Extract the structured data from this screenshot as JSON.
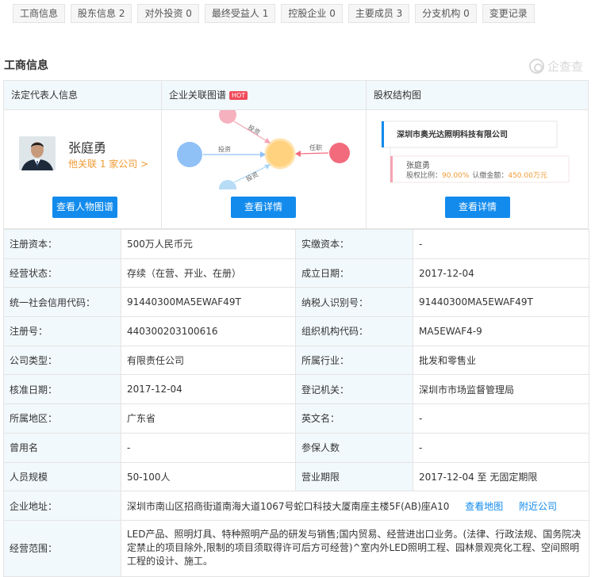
{
  "tabs": [
    "工商信息",
    "股东信息 2",
    "对外投资 0",
    "最终受益人 1",
    "控股企业 0",
    "主要成员 3",
    "分支机构 0",
    "变更记录"
  ],
  "section_title": "工商信息",
  "logo_text": "企查查",
  "legal_card": {
    "title": "法定代表人信息",
    "name": "张庭勇",
    "link": "他关联 1 家公司 >",
    "button": "查看人物图谱"
  },
  "graph_card": {
    "title": "企业关联图谱",
    "hot": "HOT",
    "labels": {
      "invest1": "投资",
      "invest2": "投资",
      "invest3": "投资",
      "role": "任职"
    },
    "button": "查看详情"
  },
  "equity_card": {
    "title": "股权结构图",
    "company": "深圳市奥光达照明科技有限公司",
    "person": "张庭勇",
    "ratio_label": "股权比例：",
    "ratio": "90.00%",
    "amount_label": "认缴金额：",
    "amount": "450.00万元",
    "button": "查看详情"
  },
  "info_rows": [
    {
      "k1": "注册资本：",
      "v1": "500万人民币元",
      "k2": "实缴资本：",
      "v2": "-"
    },
    {
      "k1": "经营状态：",
      "v1": "存续（在营、开业、在册）",
      "k2": "成立日期：",
      "v2": "2017-12-04"
    },
    {
      "k1": "统一社会信用代码：",
      "v1": "91440300MA5EWAF49T",
      "k2": "纳税人识别号：",
      "v2": "91440300MA5EWAF49T"
    },
    {
      "k1": "注册号：",
      "v1": "440300203100616",
      "k2": "组织机构代码：",
      "v2": "MA5EWAF4-9"
    },
    {
      "k1": "公司类型：",
      "v1": "有限责任公司",
      "k2": "所属行业：",
      "v2": "批发和零售业"
    },
    {
      "k1": "核准日期：",
      "v1": "2017-12-04",
      "k2": "登记机关：",
      "v2": "深圳市市场监督管理局"
    },
    {
      "k1": "所属地区：",
      "v1": "广东省",
      "k2": "英文名：",
      "v2": "-"
    },
    {
      "k1": "曾用名",
      "v1": "-",
      "k2": "参保人数",
      "v2": "-"
    },
    {
      "k1": "人员规模",
      "v1": "50-100人",
      "k2": "营业期限",
      "v2": "2017-12-04 至 无固定期限"
    }
  ],
  "address": {
    "label": "企业地址：",
    "value": "深圳市南山区招商街道南海大道1067号蛇口科技大厦南座主楼5F(AB)座A10",
    "map_link": "查看地图",
    "nearby_link": "附近公司"
  },
  "scope": {
    "label": "经营范围：",
    "value": "LED产品、照明灯具、特种照明产品的研发与销售;国内贸易、经营进出口业务。(法律、行政法规、国务院决定禁止的项目除外,限制的项目须取得许可后方可经营)^室内外LED照明工程、园林景观亮化工程、空间照明工程的设计、施工。"
  },
  "colors": {
    "accent": "#128bed",
    "header_bg": "#f2f9fc",
    "hot": "#f04a5a",
    "orange": "#f09b34"
  }
}
